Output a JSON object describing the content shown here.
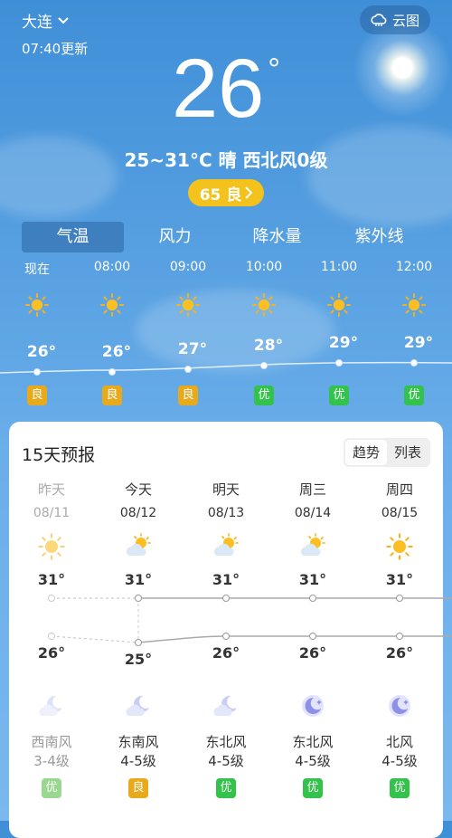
{
  "header": {
    "city": "大连",
    "updated": "07:40更新",
    "radar_label": "云图"
  },
  "current": {
    "temp": "26",
    "deg": "°",
    "summary": "25~31°C  晴  西北风0级",
    "aqi_label": "65 良"
  },
  "tabs": [
    "气温",
    "风力",
    "降水量",
    "紫外线"
  ],
  "hourly": [
    {
      "time": "现在",
      "temp": "26°",
      "temp_value": 26,
      "aqi": "良",
      "aqi_color": "#e8a91a"
    },
    {
      "time": "08:00",
      "temp": "26°",
      "temp_value": 26,
      "aqi": "良",
      "aqi_color": "#e8a91a"
    },
    {
      "time": "09:00",
      "temp": "27°",
      "temp_value": 27,
      "aqi": "良",
      "aqi_color": "#e8a91a"
    },
    {
      "time": "10:00",
      "temp": "28°",
      "temp_value": 28,
      "aqi": "优",
      "aqi_color": "#33c24b"
    },
    {
      "time": "11:00",
      "temp": "29°",
      "temp_value": 29,
      "aqi": "优",
      "aqi_color": "#33c24b"
    },
    {
      "time": "12:00",
      "temp": "29°",
      "temp_value": 29,
      "aqi": "优",
      "aqi_color": "#33c24b"
    }
  ],
  "forecast": {
    "title": "15天预报",
    "toggle": [
      "趋势",
      "列表"
    ],
    "days": [
      {
        "name": "昨天",
        "date": "08/11",
        "high": "31°",
        "low": "26°",
        "wind_dir": "西南风",
        "wind_level": "3-4级",
        "aqi": "优",
        "aqi_color": "#9ad88f",
        "icon_day": "sun-icon",
        "icon_night": "moon-cloud-icon",
        "past": true
      },
      {
        "name": "今天",
        "date": "08/12",
        "high": "31°",
        "low": "25°",
        "wind_dir": "东南风",
        "wind_level": "4-5级",
        "aqi": "良",
        "aqi_color": "#e8a91a",
        "icon_day": "sun-cloud-icon",
        "icon_night": "moon-cloud-icon",
        "past": false
      },
      {
        "name": "明天",
        "date": "08/13",
        "high": "31°",
        "low": "26°",
        "wind_dir": "东北风",
        "wind_level": "4-5级",
        "aqi": "优",
        "aqi_color": "#33c24b",
        "icon_day": "sun-cloud-icon",
        "icon_night": "moon-cloud-icon",
        "past": false
      },
      {
        "name": "周三",
        "date": "08/14",
        "high": "31°",
        "low": "26°",
        "wind_dir": "东北风",
        "wind_level": "4-5级",
        "aqi": "优",
        "aqi_color": "#33c24b",
        "icon_day": "sun-cloud-icon",
        "icon_night": "moon-star-icon",
        "past": false
      },
      {
        "name": "周四",
        "date": "08/15",
        "high": "31°",
        "low": "26°",
        "wind_dir": "北风",
        "wind_level": "4-5级",
        "aqi": "优",
        "aqi_color": "#33c24b",
        "icon_day": "sun-icon",
        "icon_night": "moon-star-icon",
        "past": false
      }
    ]
  }
}
